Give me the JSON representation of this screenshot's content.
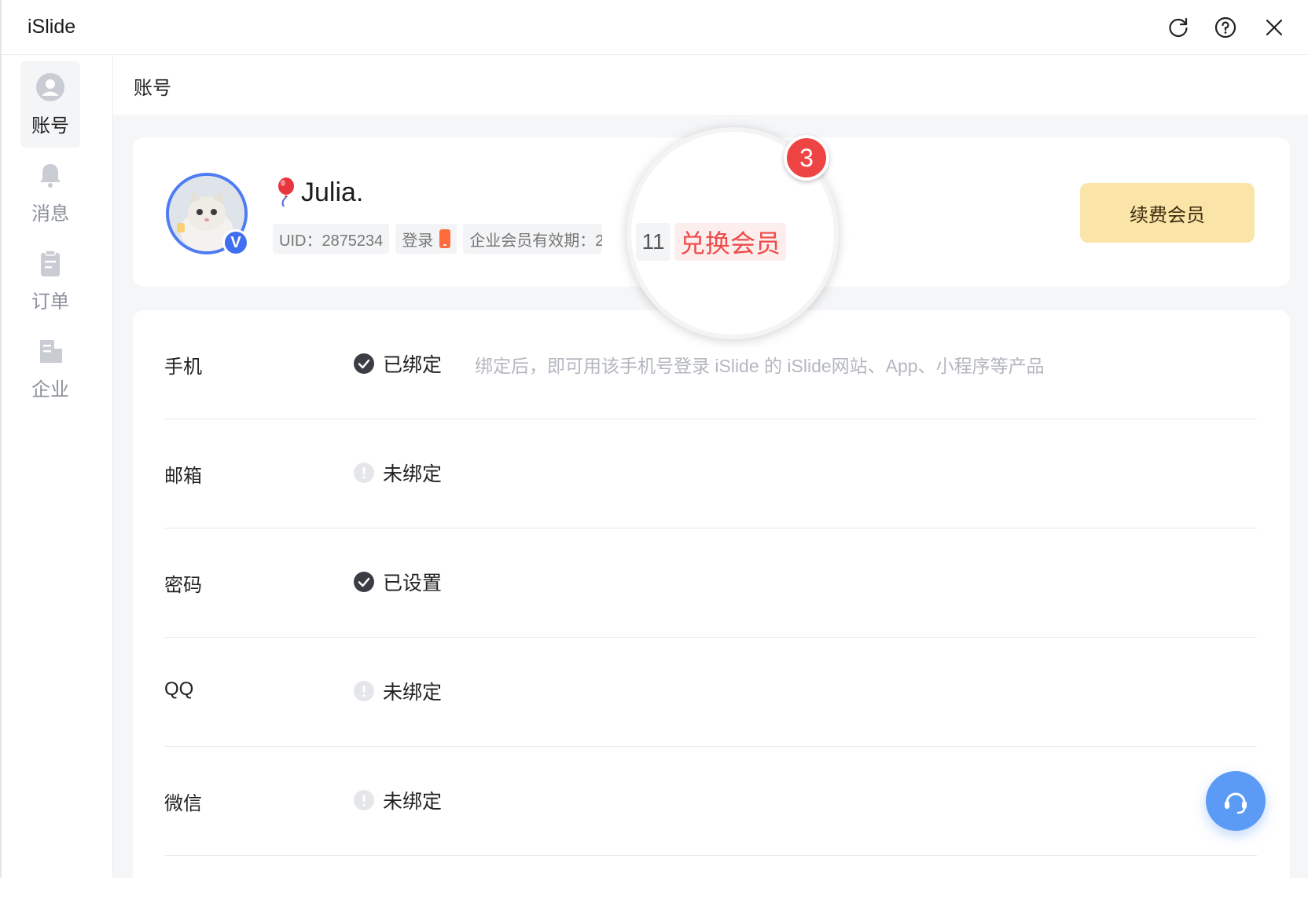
{
  "app": {
    "title": "iSlide"
  },
  "sidebar": {
    "items": [
      {
        "label": "账号",
        "icon": "user-icon",
        "active": true
      },
      {
        "label": "消息",
        "icon": "bell-icon",
        "active": false
      },
      {
        "label": "订单",
        "icon": "clipboard-icon",
        "active": false
      },
      {
        "label": "企业",
        "icon": "building-icon",
        "active": false
      }
    ]
  },
  "main": {
    "title": "账号"
  },
  "profile": {
    "name": "Julia.",
    "verified_badge": "V",
    "uid": "UID：2875234",
    "login_label": "登录",
    "membership_validity": "企业会员有效期：20",
    "year_fragment": "11",
    "redeem_label": "兑换会员",
    "renew_label": "续费会员",
    "step_number": "3"
  },
  "settings": {
    "rows": [
      {
        "label": "手机",
        "status": "已绑定",
        "state": "bound",
        "hint": "绑定后，即可用该手机号登录 iSlide 的 iSlide网站、App、小程序等产品"
      },
      {
        "label": "邮箱",
        "status": "未绑定",
        "state": "unbound",
        "hint": ""
      },
      {
        "label": "密码",
        "status": "已设置",
        "state": "bound",
        "hint": ""
      },
      {
        "label": "QQ",
        "status": "未绑定",
        "state": "unbound",
        "hint": ""
      },
      {
        "label": "微信",
        "status": "未绑定",
        "state": "unbound",
        "hint": ""
      }
    ]
  },
  "colors": {
    "accent_blue": "#4f7cf2",
    "redeem_red": "#ef4a4a",
    "renew_gold": "#fbe4a8",
    "badge_red": "#ef4444"
  }
}
